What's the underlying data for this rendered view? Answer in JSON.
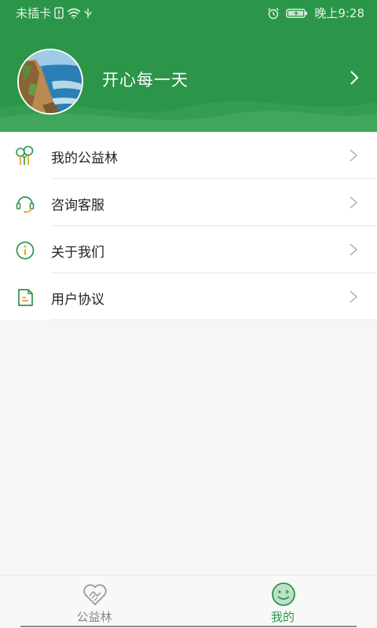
{
  "status_bar": {
    "carrier": "未插卡",
    "time": "晚上9:28",
    "icons": [
      "sim-alert-icon",
      "wifi-icon",
      "usb-icon",
      "alarm-icon",
      "battery-charging-icon"
    ]
  },
  "profile": {
    "username": "开心每一天",
    "avatar": "coastal-cliff-photo"
  },
  "menu": {
    "items": [
      {
        "label": "我的公益林",
        "icon": "forest-icon"
      },
      {
        "label": "咨询客服",
        "icon": "headset-icon"
      },
      {
        "label": "关于我们",
        "icon": "info-icon"
      },
      {
        "label": "用户协议",
        "icon": "document-icon"
      }
    ]
  },
  "bottom_nav": {
    "tabs": [
      {
        "label": "公益林",
        "icon": "handshake-heart-icon",
        "active": false
      },
      {
        "label": "我的",
        "icon": "smiley-icon",
        "active": true
      }
    ]
  },
  "colors": {
    "brand_green": "#2b9549",
    "icon_orange": "#e8a21c",
    "text_dark": "#222222",
    "text_muted": "#888888"
  }
}
